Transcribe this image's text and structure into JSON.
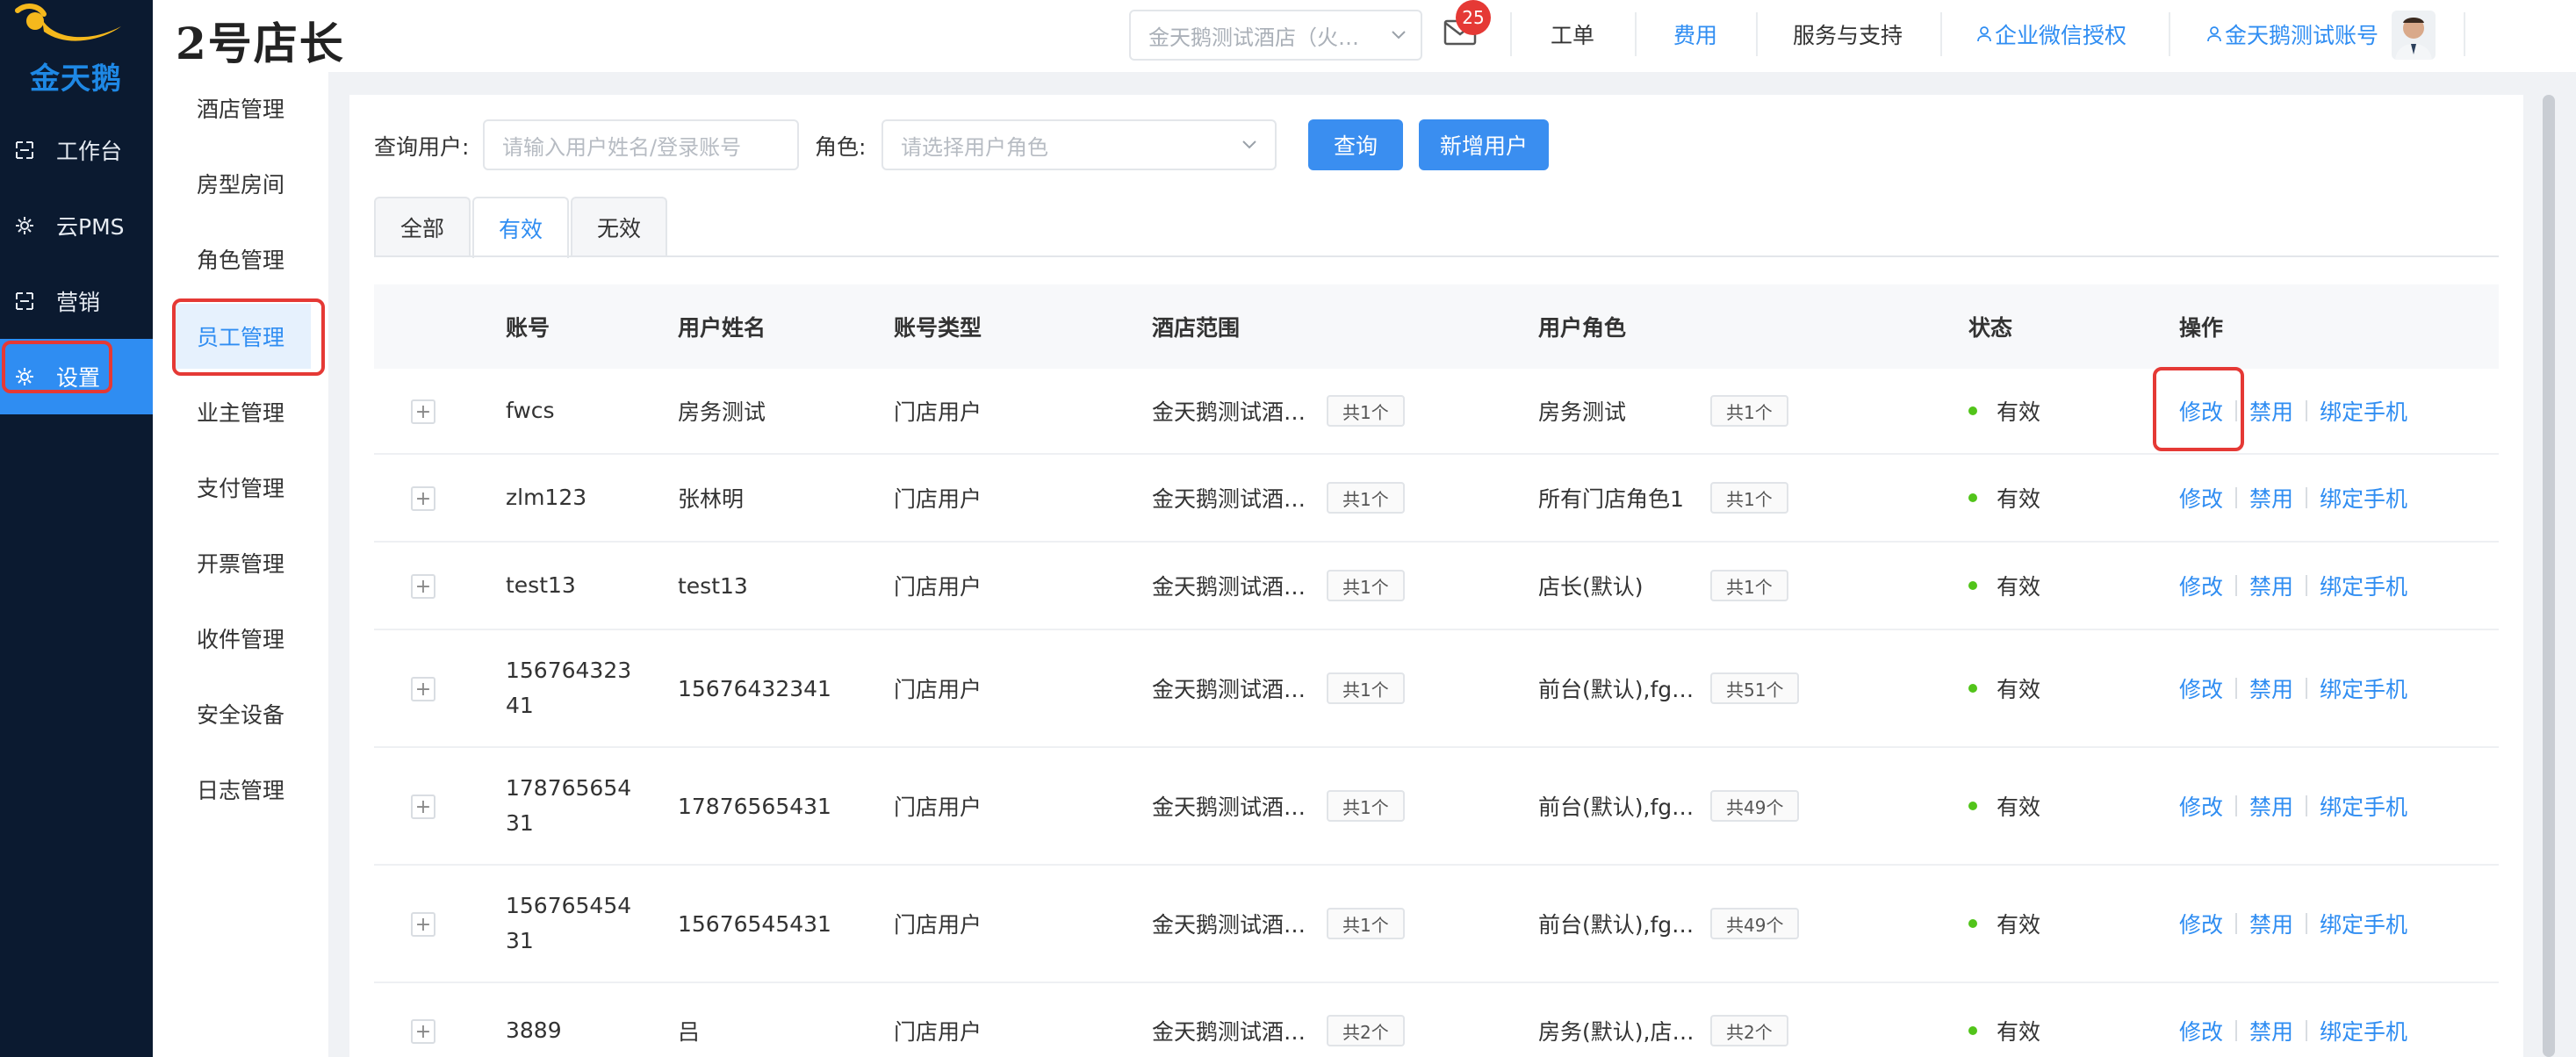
{
  "logo": {
    "text": "金天鹅"
  },
  "main_nav": [
    {
      "label": "工作台",
      "icon": "workbench-icon"
    },
    {
      "label": "云PMS",
      "icon": "gear-icon"
    },
    {
      "label": "营销",
      "icon": "marketing-icon"
    },
    {
      "label": "设置",
      "icon": "settings-icon",
      "active": true
    }
  ],
  "header": {
    "brand": "2号店长",
    "hotel_select": "金天鹅测试酒店（火…",
    "mail_badge": "25",
    "nav": {
      "ticket": "工单",
      "fee": "费用",
      "support": "服务与支持",
      "wechat": "企业微信授权",
      "account": "金天鹅测试账号"
    }
  },
  "sub_nav": [
    "酒店管理",
    "房型房间",
    "角色管理",
    "员工管理",
    "业主管理",
    "支付管理",
    "开票管理",
    "收件管理",
    "安全设备",
    "日志管理"
  ],
  "filters": {
    "user_label": "查询用户:",
    "user_placeholder": "请输入用户姓名/登录账号",
    "role_label": "角色:",
    "role_placeholder": "请选择用户角色",
    "search_btn": "查询",
    "add_btn": "新增用户"
  },
  "tabs": [
    "全部",
    "有效",
    "无效"
  ],
  "table": {
    "headers": [
      "账号",
      "用户姓名",
      "账号类型",
      "酒店范围",
      "用户角色",
      "状态",
      "操作"
    ],
    "actions": {
      "edit": "修改",
      "disable": "禁用",
      "bind": "绑定手机"
    },
    "expand": "+",
    "rows": [
      {
        "account": "fwcs",
        "name": "房务测试",
        "type": "门店用户",
        "hotel": "金天鹅测试酒…",
        "hotel_count": "共1个",
        "role": "房务测试",
        "role_count": "共1个",
        "status": "有效"
      },
      {
        "account": "zlm123",
        "name": "张林明",
        "type": "门店用户",
        "hotel": "金天鹅测试酒…",
        "hotel_count": "共1个",
        "role": "所有门店角色1",
        "role_count": "共1个",
        "status": "有效"
      },
      {
        "account": "test13",
        "name": "test13",
        "type": "门店用户",
        "hotel": "金天鹅测试酒…",
        "hotel_count": "共1个",
        "role": "店长(默认)",
        "role_count": "共1个",
        "status": "有效"
      },
      {
        "account": "15676432341",
        "name": "15676432341",
        "type": "门店用户",
        "hotel": "金天鹅测试酒…",
        "hotel_count": "共1个",
        "role": "前台(默认),fg…",
        "role_count": "共51个",
        "status": "有效"
      },
      {
        "account": "17876565431",
        "name": "17876565431",
        "type": "门店用户",
        "hotel": "金天鹅测试酒…",
        "hotel_count": "共1个",
        "role": "前台(默认),fg…",
        "role_count": "共49个",
        "status": "有效"
      },
      {
        "account": "15676545431",
        "name": "15676545431",
        "type": "门店用户",
        "hotel": "金天鹅测试酒…",
        "hotel_count": "共1个",
        "role": "前台(默认),fg…",
        "role_count": "共49个",
        "status": "有效"
      },
      {
        "account": "3889",
        "name": "吕",
        "type": "门店用户",
        "hotel": "金天鹅测试酒…",
        "hotel_count": "共2个",
        "role": "房务(默认),店…",
        "role_count": "共2个",
        "status": "有效"
      }
    ]
  },
  "colors": {
    "accent": "#2f8df2",
    "sidebar": "#0b1a30",
    "highlight": "#e53935",
    "status_ok": "#52c41a"
  }
}
